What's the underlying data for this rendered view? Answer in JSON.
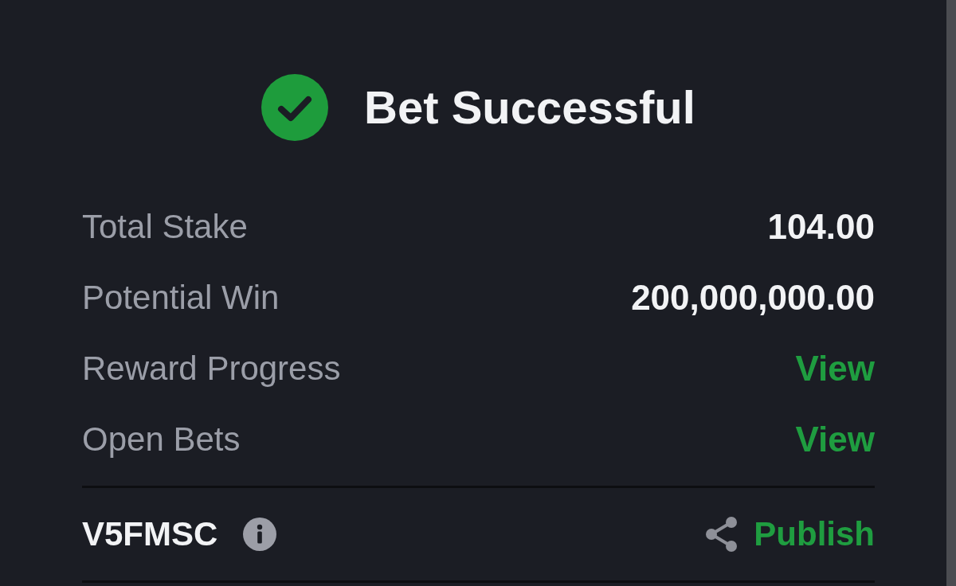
{
  "header": {
    "title": "Bet Successful"
  },
  "details": [
    {
      "label": "Total Stake",
      "value": "104.00",
      "kind": "amount"
    },
    {
      "label": "Potential Win",
      "value": "200,000,000.00",
      "kind": "amount"
    },
    {
      "label": "Reward Progress",
      "value": "View",
      "kind": "link"
    },
    {
      "label": "Open Bets",
      "value": "View",
      "kind": "link"
    }
  ],
  "ticket": {
    "code": "V5FMSC",
    "action": "Publish"
  }
}
